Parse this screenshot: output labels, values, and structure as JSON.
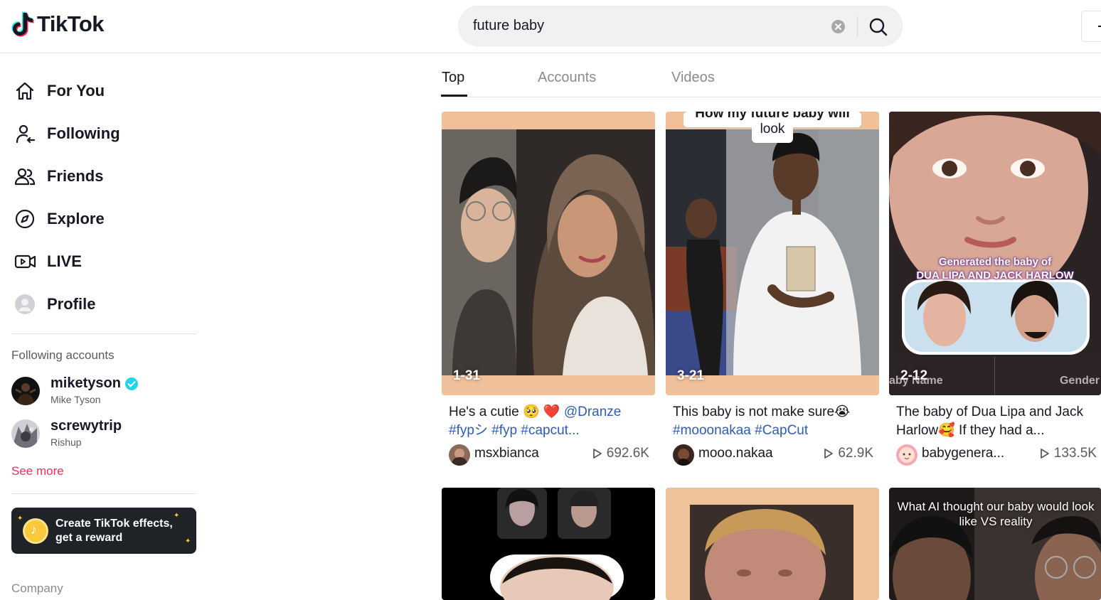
{
  "header": {
    "logo_text": "TikTok",
    "search_value": "future baby"
  },
  "sidebar": {
    "nav": [
      {
        "label": "For You",
        "icon": "home-icon"
      },
      {
        "label": "Following",
        "icon": "following-icon"
      },
      {
        "label": "Friends",
        "icon": "friends-icon"
      },
      {
        "label": "Explore",
        "icon": "compass-icon"
      },
      {
        "label": "LIVE",
        "icon": "live-camera-icon"
      },
      {
        "label": "Profile",
        "icon": "profile-avatar-icon"
      }
    ],
    "following_title": "Following accounts",
    "accounts": [
      {
        "name": "miketyson",
        "sub": "Mike Tyson",
        "verified": true
      },
      {
        "name": "screwytrip",
        "sub": "Rishup",
        "verified": false
      }
    ],
    "see_more": "See more",
    "effects_banner": "Create TikTok effects, get a reward",
    "company": "Company"
  },
  "tabs": [
    {
      "label": "Top",
      "active": true
    },
    {
      "label": "Accounts",
      "active": false
    },
    {
      "label": "Videos",
      "active": false
    }
  ],
  "cards": [
    {
      "date": "1-31",
      "desc_text": "He's a cutie 🥺 ❤️ ",
      "desc_tags": "@Dranze",
      "desc_line2": "#fypシ #fyp #capcut...",
      "user": "msxbianca",
      "views": "692.6K"
    },
    {
      "date": "3-21",
      "overlay_top": "How my future baby will",
      "overlay_bottom": "look",
      "desc_text": "This baby is not make sure😭",
      "desc_line2": "#mooonakaa #CapCut",
      "user": "mooo.nakaa",
      "views": "62.9K"
    },
    {
      "date": "2-12",
      "overlay_line1": "Generated the baby of",
      "overlay_line2": "DUA LIPA AND JACK HARLOW",
      "labels_left": "aby Name",
      "labels_right": "Gender",
      "desc_text": "The baby of Dua Lipa and Jack Harlow🥰 If they had a...",
      "user": "babygenera...",
      "views": "133.5K"
    }
  ],
  "row2": [
    {
      "overlay": ""
    },
    {
      "overlay": ""
    },
    {
      "overlay": "What AI thought our baby would look like VS reality"
    }
  ],
  "colors": {
    "accent": "#fe2c55",
    "tag": "#2b5db9",
    "verified": "#20d5ec",
    "card_peach": "#f0c09a"
  }
}
